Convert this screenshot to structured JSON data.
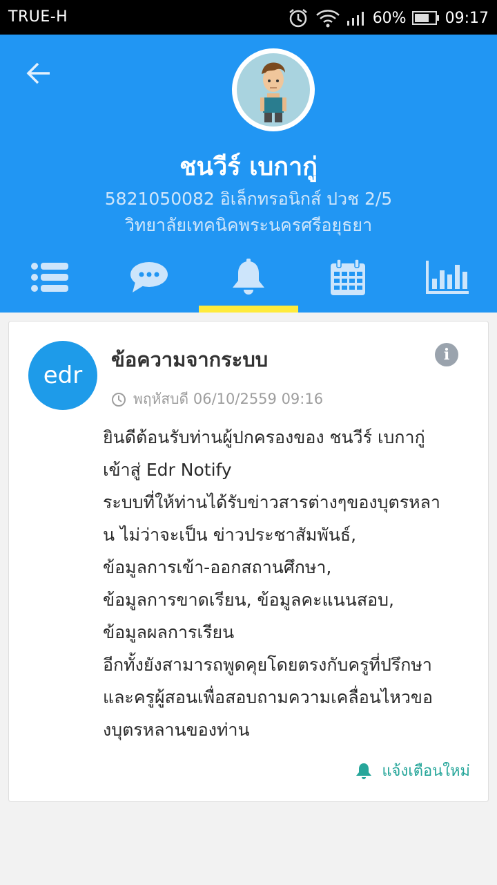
{
  "status_bar": {
    "carrier": "TRUE-H",
    "battery": "60%",
    "time": "09:17",
    "icons": [
      "alarm-icon",
      "wifi-icon",
      "signal-icon",
      "battery-icon"
    ]
  },
  "header": {
    "background": "#2196f3",
    "back_icon": "arrow-left-icon",
    "name": "ชนวีร์ เบกากู่",
    "student_info": "5821050082 อิเล็กทรอนิกส์ ปวช 2/5",
    "school": "วิทยาลัยเทคนิคพระนครศรีอยุธยา"
  },
  "tabs": [
    {
      "icon": "list-icon",
      "active": false
    },
    {
      "icon": "chat-icon",
      "active": false
    },
    {
      "icon": "bell-icon",
      "active": true
    },
    {
      "icon": "calendar-icon",
      "active": false
    },
    {
      "icon": "bar-chart-icon",
      "active": false
    }
  ],
  "tab_indicator_color": "#ffeb3b",
  "card": {
    "logo_text": "edr",
    "title": "ข้อความจากระบบ",
    "info_label": "i",
    "timestamp": "พฤหัสบดี 06/10/2559 09:16",
    "message_lines": [
      "ยินดีต้อนรับท่านผู้ปกครองของ ชนวีร์ เบกากู่",
      "เข้าสู่ Edr Notify",
      "ระบบที่ให้ท่านได้รับข่าวสารต่างๆของบุตรหลา",
      "น ไม่ว่าจะเป็น ข่าวประชาสัมพันธ์,",
      "ข้อมูลการเข้า-ออกสถานศึกษา,",
      "ข้อมูลการขาดเรียน, ข้อมูลคะแนนสอบ,",
      "ข้อมูลผลการเรียน",
      "อีกทั้งยังสามารถพูดคุยโดยตรงกับครูที่ปรึกษา",
      "และครูผู้สอนเพื่อสอบถามความเคลื่อนไหวขอ",
      "งบุตรหลานของท่าน"
    ],
    "notify_label": "แจ้งเตือนใหม่",
    "notify_color": "#26a69a"
  }
}
